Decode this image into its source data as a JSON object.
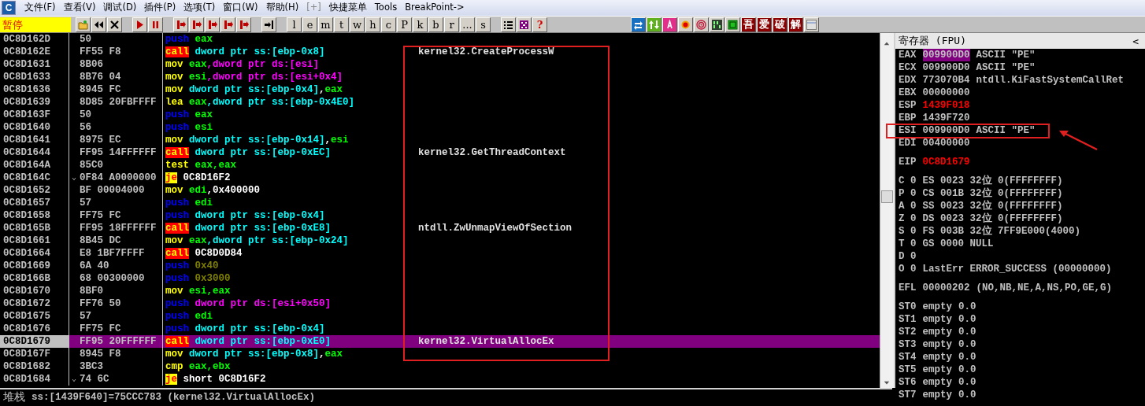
{
  "app_icon": "C",
  "menu": [
    {
      "label": "文件(F)",
      "disabled": false
    },
    {
      "label": "查看(V)",
      "disabled": false
    },
    {
      "label": "调试(D)",
      "disabled": false
    },
    {
      "label": "插件(P)",
      "disabled": false
    },
    {
      "label": "选项(T)",
      "disabled": false
    },
    {
      "label": "窗口(W)",
      "disabled": false
    },
    {
      "label": "帮助(H)",
      "disabled": false
    },
    {
      "label": "[+]",
      "disabled": true
    },
    {
      "label": "快捷菜单",
      "disabled": false
    },
    {
      "label": "Tools",
      "disabled": false
    },
    {
      "label": "BreakPoint->",
      "disabled": false
    }
  ],
  "run_state": "暂停",
  "letter_buttons": [
    "l",
    "e",
    "m",
    "t",
    "w",
    "h",
    "c",
    "P",
    "k",
    "b",
    "r",
    "...",
    "s"
  ],
  "help_button": "?",
  "plugin_buttons": [
    "吾",
    "爱",
    "破",
    "解"
  ],
  "disassembly": [
    {
      "address": "0C8D162D",
      "hex": "50",
      "ins": [
        {
          "text": "push",
          "kind": "push"
        },
        {
          "text": " eax",
          "kind": "reg"
        }
      ],
      "selected": false
    },
    {
      "address": "0C8D162E",
      "hex": "FF55 F8",
      "ins": [
        {
          "text": "call",
          "kind": "call"
        },
        {
          "text": " dword ptr ss:[ebp-0x8]",
          "kind": "ss"
        }
      ],
      "comment": "kernel32.CreateProcessW",
      "selected": false
    },
    {
      "address": "0C8D1631",
      "hex": "8B06",
      "ins": [
        {
          "text": "mov",
          "kind": "op"
        },
        {
          "text": " eax",
          "kind": "reg"
        },
        {
          "text": ",dword ptr ds:[esi]",
          "kind": "ds"
        }
      ],
      "selected": false
    },
    {
      "address": "0C8D1633",
      "hex": "8B76 04",
      "ins": [
        {
          "text": "mov",
          "kind": "op"
        },
        {
          "text": " esi",
          "kind": "reg"
        },
        {
          "text": ",dword ptr ds:[esi+0x4]",
          "kind": "ds"
        }
      ],
      "selected": false
    },
    {
      "address": "0C8D1636",
      "hex": "8945 FC",
      "ins": [
        {
          "text": "mov",
          "kind": "op"
        },
        {
          "text": " dword ptr ss:[ebp-0x4]",
          "kind": "ss"
        },
        {
          "text": ",",
          "kind": "plain"
        },
        {
          "text": "eax",
          "kind": "reg"
        }
      ],
      "selected": false
    },
    {
      "address": "0C8D1639",
      "hex": "8D85 20FBFFFF",
      "ins": [
        {
          "text": "lea",
          "kind": "op"
        },
        {
          "text": " eax",
          "kind": "reg"
        },
        {
          "text": ",dword ptr ss:[ebp-0x4E0]",
          "kind": "ss"
        }
      ],
      "selected": false
    },
    {
      "address": "0C8D163F",
      "hex": "50",
      "ins": [
        {
          "text": "push",
          "kind": "push"
        },
        {
          "text": " eax",
          "kind": "reg"
        }
      ],
      "selected": false
    },
    {
      "address": "0C8D1640",
      "hex": "56",
      "ins": [
        {
          "text": "push",
          "kind": "push"
        },
        {
          "text": " esi",
          "kind": "reg"
        }
      ],
      "selected": false
    },
    {
      "address": "0C8D1641",
      "hex": "8975 EC",
      "ins": [
        {
          "text": "mov",
          "kind": "op"
        },
        {
          "text": " dword ptr ss:[ebp-0x14]",
          "kind": "ss"
        },
        {
          "text": ",",
          "kind": "plain"
        },
        {
          "text": "esi",
          "kind": "reg"
        }
      ],
      "selected": false
    },
    {
      "address": "0C8D1644",
      "hex": "FF95 14FFFFFF",
      "ins": [
        {
          "text": "call",
          "kind": "call"
        },
        {
          "text": " dword ptr ss:[ebp-0xEC]",
          "kind": "ss"
        }
      ],
      "comment": "kernel32.GetThreadContext",
      "selected": false
    },
    {
      "address": "0C8D164A",
      "hex": "85C0",
      "ins": [
        {
          "text": "test",
          "kind": "op"
        },
        {
          "text": " eax,eax",
          "kind": "reg"
        }
      ],
      "selected": false
    },
    {
      "address": "0C8D164C",
      "mark": "⌄",
      "hex": "0F84 A0000000",
      "ins": [
        {
          "text": "je",
          "kind": "jump"
        },
        {
          "text": " 0C8D16F2",
          "kind": "plain"
        }
      ],
      "selected": false
    },
    {
      "address": "0C8D1652",
      "hex": "BF 00004000",
      "ins": [
        {
          "text": "mov",
          "kind": "op"
        },
        {
          "text": " edi",
          "kind": "reg"
        },
        {
          "text": ",0x400000",
          "kind": "plain"
        }
      ],
      "selected": false
    },
    {
      "address": "0C8D1657",
      "hex": "57",
      "ins": [
        {
          "text": "push",
          "kind": "push"
        },
        {
          "text": " edi",
          "kind": "reg"
        }
      ],
      "selected": false
    },
    {
      "address": "0C8D1658",
      "hex": "FF75 FC",
      "ins": [
        {
          "text": "push",
          "kind": "push"
        },
        {
          "text": " dword ptr ss:[ebp-0x4]",
          "kind": "ss"
        }
      ],
      "selected": false
    },
    {
      "address": "0C8D165B",
      "hex": "FF95 18FFFFFF",
      "ins": [
        {
          "text": "call",
          "kind": "call"
        },
        {
          "text": " dword ptr ss:[ebp-0xE8]",
          "kind": "ss"
        }
      ],
      "comment": "ntdll.ZwUnmapViewOfSection",
      "selected": false
    },
    {
      "address": "0C8D1661",
      "hex": "8B45 DC",
      "ins": [
        {
          "text": "mov",
          "kind": "op"
        },
        {
          "text": " eax",
          "kind": "reg"
        },
        {
          "text": ",dword ptr ss:[ebp-0x24]",
          "kind": "ss"
        }
      ],
      "selected": false
    },
    {
      "address": "0C8D1664",
      "hex": "E8 1BF7FFFF",
      "ins": [
        {
          "text": "call",
          "kind": "call"
        },
        {
          "text": " 0C8D0D84",
          "kind": "plain"
        }
      ],
      "selected": false
    },
    {
      "address": "0C8D1669",
      "hex": "6A 40",
      "ins": [
        {
          "text": "push",
          "kind": "push"
        },
        {
          "text": " 0x40",
          "kind": "const"
        }
      ],
      "selected": false
    },
    {
      "address": "0C8D166B",
      "hex": "68 00300000",
      "ins": [
        {
          "text": "push",
          "kind": "push"
        },
        {
          "text": " 0x3000",
          "kind": "const"
        }
      ],
      "selected": false
    },
    {
      "address": "0C8D1670",
      "hex": "8BF0",
      "ins": [
        {
          "text": "mov",
          "kind": "op"
        },
        {
          "text": " esi,eax",
          "kind": "reg"
        }
      ],
      "selected": false
    },
    {
      "address": "0C8D1672",
      "hex": "FF76 50",
      "ins": [
        {
          "text": "push",
          "kind": "push"
        },
        {
          "text": " dword ptr ds:[esi+0x50]",
          "kind": "ds"
        }
      ],
      "selected": false
    },
    {
      "address": "0C8D1675",
      "hex": "57",
      "ins": [
        {
          "text": "push",
          "kind": "push"
        },
        {
          "text": " edi",
          "kind": "reg"
        }
      ],
      "selected": false
    },
    {
      "address": "0C8D1676",
      "hex": "FF75 FC",
      "ins": [
        {
          "text": "push",
          "kind": "push"
        },
        {
          "text": " dword ptr ss:[ebp-0x4]",
          "kind": "ss"
        }
      ],
      "selected": false
    },
    {
      "address": "0C8D1679",
      "hex": "FF95 20FFFFFF",
      "ins": [
        {
          "text": "call",
          "kind": "call"
        },
        {
          "text": " dword ptr ss:[ebp-0xE0]",
          "kind": "ss"
        }
      ],
      "comment": "kernel32.VirtualAllocEx",
      "selected": true
    },
    {
      "address": "0C8D167F",
      "hex": "8945 F8",
      "ins": [
        {
          "text": "mov",
          "kind": "op"
        },
        {
          "text": " dword ptr ss:[ebp-0x8]",
          "kind": "ss"
        },
        {
          "text": ",",
          "kind": "plain"
        },
        {
          "text": "eax",
          "kind": "reg"
        }
      ],
      "selected": false
    },
    {
      "address": "0C8D1682",
      "hex": "3BC3",
      "ins": [
        {
          "text": "cmp",
          "kind": "op"
        },
        {
          "text": " eax,ebx",
          "kind": "reg"
        }
      ],
      "selected": false
    },
    {
      "address": "0C8D1684",
      "mark": "⌄",
      "hex": "74 6C",
      "ins": [
        {
          "text": "je",
          "kind": "jump"
        },
        {
          "text": " short 0C8D16F2",
          "kind": "plain"
        }
      ],
      "selected": false
    }
  ],
  "info_line": {
    "label": "堆栈",
    "text": "ss:[1439F640]=75CCC783 (kernel32.VirtualAllocEx)"
  },
  "registers_panel": {
    "title": "寄存器 (FPU)",
    "collapse": "<",
    "groups": [
      [
        {
          "name": "EAX",
          "value": "009900D0",
          "comment": "ASCII \"PE\"",
          "changed": false,
          "selected": true
        },
        {
          "name": "ECX",
          "value": "009900D0",
          "comment": "ASCII \"PE\"",
          "changed": false,
          "selected": false
        },
        {
          "name": "EDX",
          "value": "773070B4",
          "comment": "ntdll.KiFastSystemCallRet",
          "changed": false,
          "selected": false
        },
        {
          "name": "EBX",
          "value": "00000000",
          "changed": false,
          "selected": false
        },
        {
          "name": "ESP",
          "value": "1439F018",
          "changed": true,
          "selected": false
        },
        {
          "name": "EBP",
          "value": "1439F720",
          "changed": false,
          "selected": false
        },
        {
          "name": "ESI",
          "value": "009900D0",
          "comment": "ASCII \"PE\"",
          "changed": false,
          "selected": false
        },
        {
          "name": "EDI",
          "value": "00400000",
          "changed": false,
          "selected": false
        }
      ],
      [
        {
          "name": "EIP",
          "value": "0C8D1679",
          "changed": true,
          "selected": false
        }
      ],
      [
        {
          "name": "C 0",
          "value": "ES 0023 32位 0(FFFFFFFF)",
          "changed": false,
          "selected": false
        },
        {
          "name": "P 0",
          "value": "CS 001B 32位 0(FFFFFFFF)",
          "changed": false,
          "selected": false
        },
        {
          "name": "A 0",
          "value": "SS 0023 32位 0(FFFFFFFF)",
          "changed": false,
          "selected": false
        },
        {
          "name": "Z 0",
          "value": "DS 0023 32位 0(FFFFFFFF)",
          "changed": false,
          "selected": false
        },
        {
          "name": "S 0",
          "value": "FS 003B 32位 7FF9E000(4000)",
          "changed": false,
          "selected": false
        },
        {
          "name": "T 0",
          "value": "GS 0000 NULL",
          "changed": false,
          "selected": false
        },
        {
          "name": "D 0",
          "changed": false,
          "selected": false
        },
        {
          "name": "O 0",
          "value": "LastErr ERROR_SUCCESS (00000000)",
          "changed": false,
          "selected": false
        }
      ],
      [
        {
          "name": "EFL",
          "value": "00000202",
          "comment": "(NO,NB,NE,A,NS,PO,GE,G)",
          "changed": false,
          "selected": false
        }
      ],
      [
        {
          "name": "ST0",
          "value": "empty",
          "comment": "0.0",
          "changed": false,
          "selected": false
        },
        {
          "name": "ST1",
          "value": "empty",
          "comment": "0.0",
          "changed": false,
          "selected": false
        },
        {
          "name": "ST2",
          "value": "empty",
          "comment": "0.0",
          "changed": false,
          "selected": false
        },
        {
          "name": "ST3",
          "value": "empty",
          "comment": "0.0",
          "changed": false,
          "selected": false
        },
        {
          "name": "ST4",
          "value": "empty",
          "comment": "0.0",
          "changed": false,
          "selected": false
        },
        {
          "name": "ST5",
          "value": "empty",
          "comment": "0.0",
          "changed": false,
          "selected": false
        },
        {
          "name": "ST6",
          "value": "empty",
          "comment": "0.0",
          "changed": false,
          "selected": false
        },
        {
          "name": "ST7",
          "value": "empty",
          "comment": "0.0",
          "changed": false,
          "selected": false
        }
      ]
    ]
  }
}
